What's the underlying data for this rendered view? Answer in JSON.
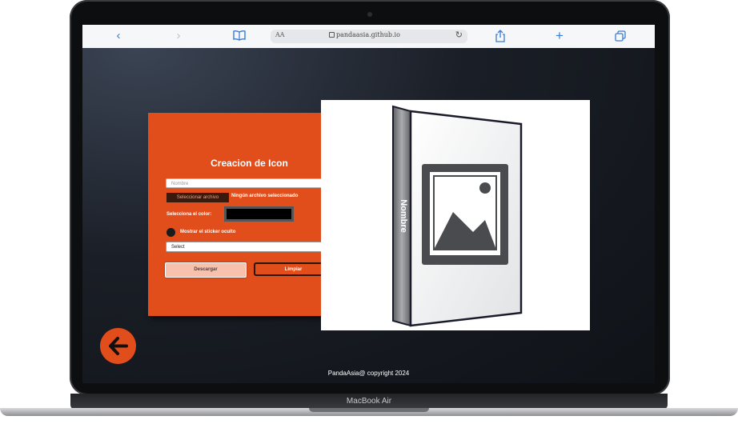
{
  "device": {
    "label": "MacBook Air"
  },
  "browser": {
    "text_size_label": "AA",
    "url": "pandaasia.github.io",
    "icons": [
      "back-icon",
      "forward-icon",
      "bookmarks-icon",
      "lock-icon",
      "reload-icon",
      "share-icon",
      "new-tab-icon",
      "tabs-icon"
    ]
  },
  "form": {
    "title": "Creacion de Icon",
    "name_placeholder": "Nombre",
    "file_button_label": "Seleccionar archivo",
    "file_status": "Ningún archivo seleccionado",
    "color_label": "Selecciona el color:",
    "color_value": "#000000",
    "sticker_label": "Mostrar el sticker oculto",
    "select_value": "Select",
    "download_label": "Descargar",
    "clear_label": "Limpiar"
  },
  "preview": {
    "spine_text": "Nombre",
    "image_icon": "image-placeholder-icon"
  },
  "footer": {
    "text": "PandaAsia@ copyright 2024"
  },
  "colors": {
    "accent": "#e24e1b",
    "background": "#14171c"
  }
}
